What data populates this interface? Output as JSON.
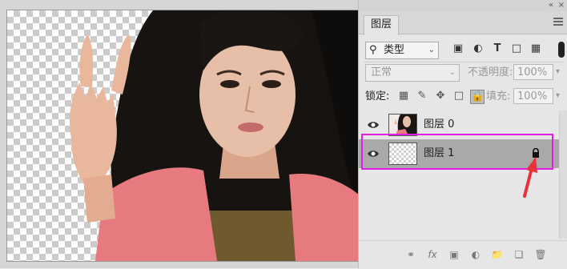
{
  "panel": {
    "tab_label": "图层",
    "filter": {
      "label": "类型",
      "icon": "search-icon"
    },
    "blend_mode": "正常",
    "opacity_label": "不透明度:",
    "opacity_value": "100%",
    "lock_label": "锁定:",
    "fill_label": "填充:",
    "fill_value": "100%",
    "layers": [
      {
        "name": "图层 0",
        "visible": true,
        "selected": false,
        "locked": false
      },
      {
        "name": "图层 1",
        "visible": true,
        "selected": true,
        "locked": true
      }
    ],
    "bottom_icons": [
      "link-icon",
      "fx-icon",
      "mask-icon",
      "adjustment-icon",
      "folder-icon",
      "new-layer-icon",
      "trash-icon"
    ],
    "bottom_fx_text": "fx"
  },
  "colors": {
    "selection_highlight": "#e21ee0",
    "arrow": "#e8323a",
    "selected_layer_bg": "#a9a9a9"
  }
}
